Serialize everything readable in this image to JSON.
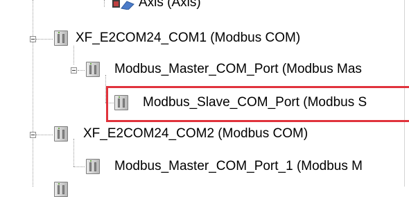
{
  "tree": {
    "axis_item": {
      "label": "Axis (Axis)",
      "icon": "axis-icon"
    },
    "com1": {
      "label": "XF_E2COM24_COM1 (Modbus COM)",
      "icon": "device-icon",
      "master": {
        "label": "Modbus_Master_COM_Port (Modbus Mas",
        "icon": "device-icon",
        "slave": {
          "label": "Modbus_Slave_COM_Port (Modbus S",
          "icon": "device-icon"
        }
      }
    },
    "com2": {
      "label": "XF_E2COM24_COM2 (Modbus COM)",
      "icon": "device-icon",
      "master": {
        "label": "Modbus_Master_COM_Port_1 (Modbus M",
        "icon": "device-icon"
      }
    }
  },
  "highlight_color": "#e0333c"
}
